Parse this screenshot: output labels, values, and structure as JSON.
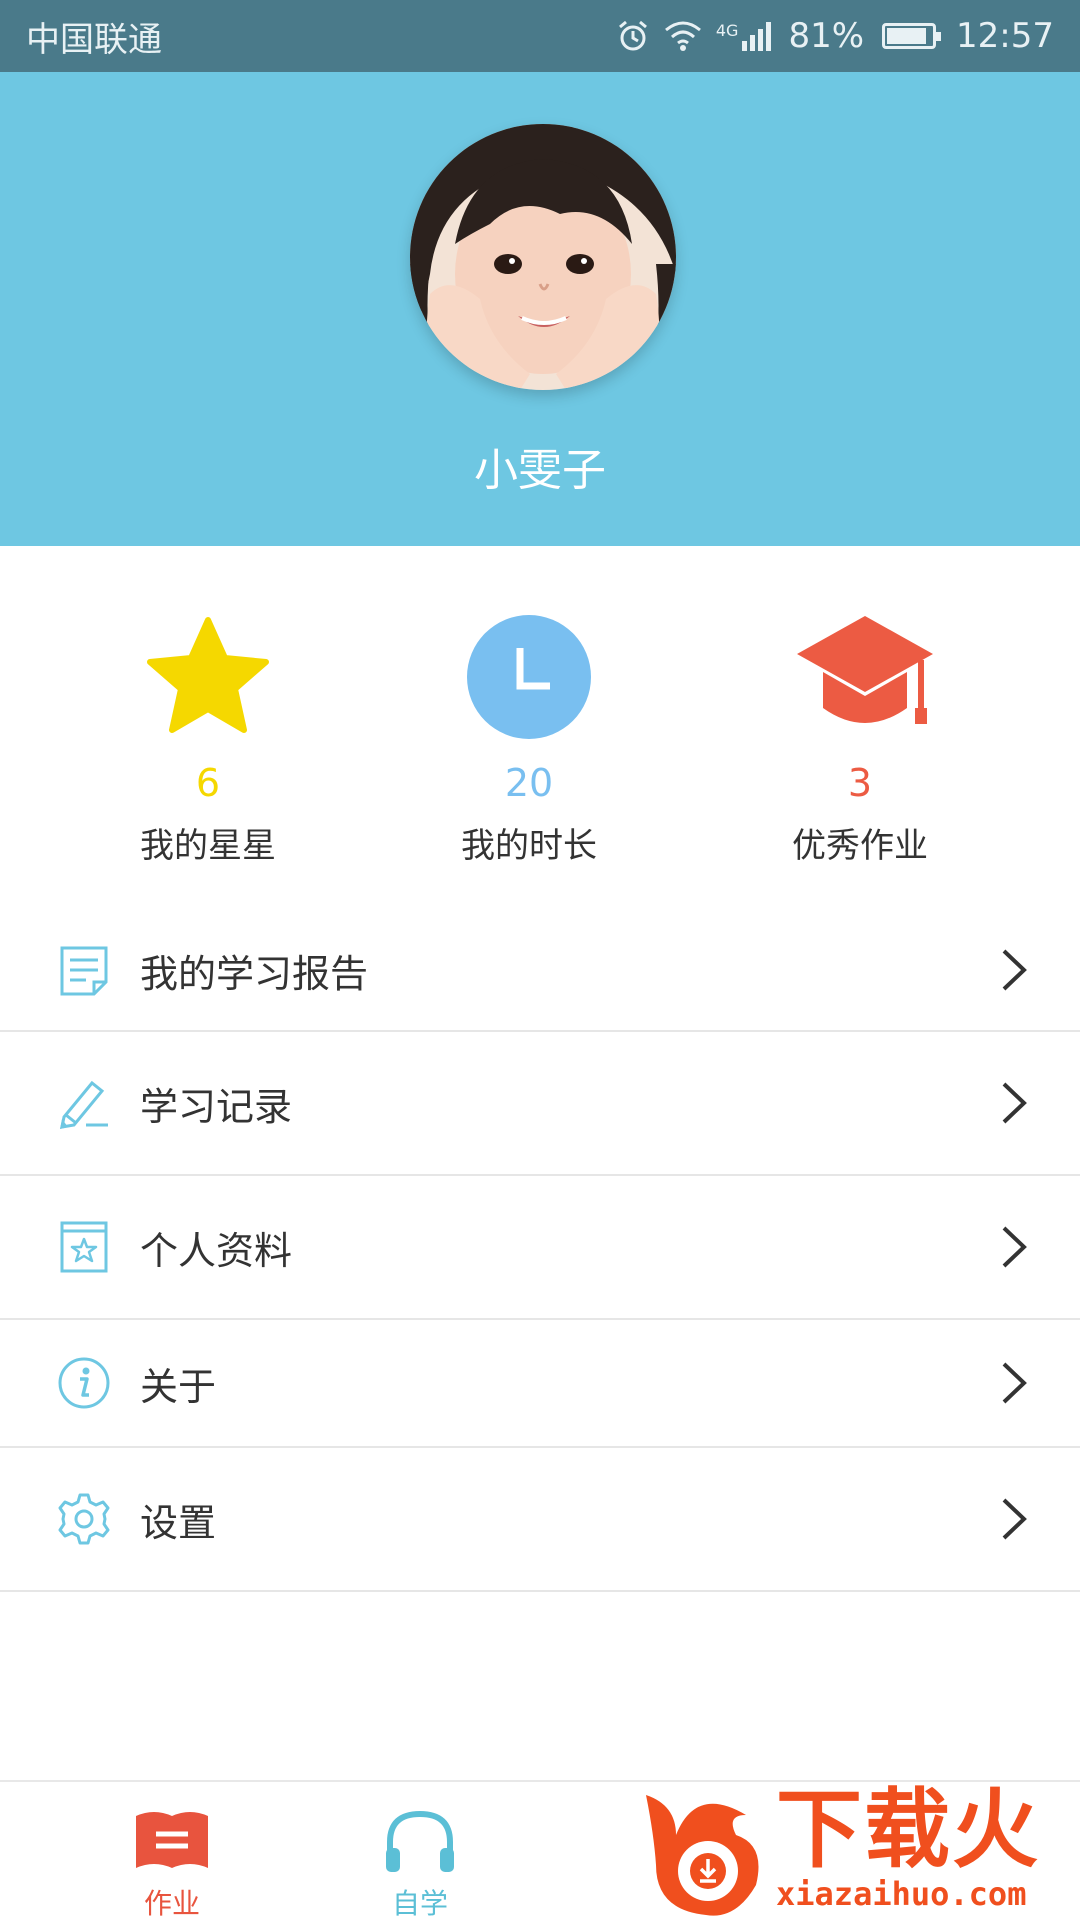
{
  "status_bar": {
    "carrier": "中国联通",
    "network": "4G",
    "battery": "81%",
    "time": "12:57"
  },
  "profile": {
    "name": "小雯子"
  },
  "stats": [
    {
      "icon": "star-icon",
      "value": "6",
      "label": "我的星星",
      "color": "#f5d800"
    },
    {
      "icon": "clock-icon",
      "value": "20",
      "label": "我的时长",
      "color": "#79bff0"
    },
    {
      "icon": "graduation-cap-icon",
      "value": "3",
      "label": "优秀作业",
      "color": "#ec5b43"
    }
  ],
  "menu": [
    {
      "icon": "report-icon",
      "label": "我的学习报告"
    },
    {
      "icon": "pencil-icon",
      "label": "学习记录"
    },
    {
      "icon": "profile-book-icon",
      "label": "个人资料"
    },
    {
      "icon": "info-icon",
      "label": "关于"
    },
    {
      "icon": "gear-icon",
      "label": "设置"
    }
  ],
  "tabbar": [
    {
      "icon": "book-icon",
      "label": "作业",
      "color": "#e8543e"
    },
    {
      "icon": "headphones-icon",
      "label": "自学",
      "color": "#5bbfd6"
    }
  ],
  "watermark": {
    "text": "下载火",
    "url": "xiazaihuo.com"
  },
  "colors": {
    "header_bg": "#6ec7e2",
    "status_bar_bg": "#4a7a8a",
    "menu_icon": "#6ec7e2"
  }
}
